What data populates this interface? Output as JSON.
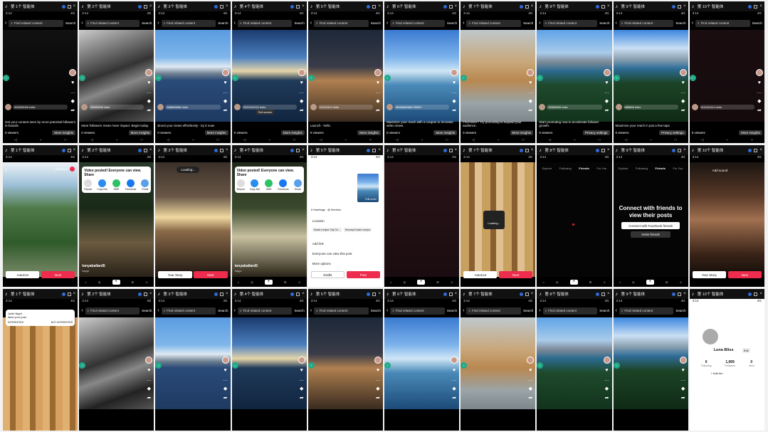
{
  "window_tabs": [
    "第 1个 智能体",
    "第 2个 智能体",
    "第 3个 智能体",
    "第 4个 智能体",
    "第 5个 智能体",
    "第 6个 智能体",
    "第 7个 智能体",
    "第 8个 智能体",
    "第 9个 智能体",
    "第 10个 智能体"
  ],
  "common": {
    "time": "3:14",
    "net": "4G",
    "search_placeholder": "Find related content",
    "search_btn": "Search",
    "viewers": "0 viewers",
    "more_insights": "More insights",
    "privacy_settings": "Privacy settings"
  },
  "row1": [
    {
      "img": "dark",
      "comment": "000000000 hello",
      "hint": "Get your content seen by more potential followers in-boards."
    },
    {
      "img": "industrial",
      "comment": "99999999 hello",
      "hint": "More followers mean more impact. Begin today."
    },
    {
      "img": "mountain",
      "comment": "888888888 hello",
      "hint": "Boost your views effortlessly - try it now!"
    },
    {
      "img": "sunset",
      "comment": "2222222222 hello",
      "hint": "",
      "full": "Full screen"
    },
    {
      "img": "woman",
      "comment": "111111111 hello",
      "hint": "Launch - hello"
    },
    {
      "img": "glacier",
      "comment": "MMMMMMM PARIS",
      "hint": "Maximize your reach with a coupon to increase video views."
    },
    {
      "img": "dog",
      "comment": "",
      "hint": "First-timer? Try promoting to expand your audience."
    },
    {
      "img": "lake",
      "comment": "55555555 hello",
      "hint": "Start promoting now to accelerate follower growth."
    },
    {
      "img": "lake2",
      "comment": "888888 hello",
      "hint": "Maximize your reach in just a few taps"
    },
    {
      "img": "dark2",
      "comment": "1111111111 hello",
      "hint": ""
    }
  ],
  "row2": {
    "selected": "Selected",
    "autocut": "AutoCut",
    "next": "Next",
    "share_title": "Video posted! Everyone can view. Share",
    "share_items": [
      "Repost",
      "Copy link",
      "SMS",
      "Facebook",
      "Email"
    ],
    "loading": "Loading...",
    "your_story": "Your Story",
    "username": "tonyaballard5",
    "sub": "happi",
    "edit_cover": "Edit cover",
    "location": "Location",
    "location_tag1": "Kuala Lumpur City Ce...",
    "location_tag2": "Sunway Kuala Lumpur",
    "add_link": "Add link",
    "privacy": "Everyone can view this post",
    "more_options": "More options",
    "drafts": "Drafts",
    "post": "Post",
    "tab_explore": "Explore",
    "tab_following": "Following",
    "tab_friends": "Friends",
    "tab_foryou": "For You",
    "connect_title": "Connect with friends to view their posts",
    "connect_fb": "Connect with Facebook friends",
    "invite": "Invite friends",
    "add_sound": "Add sound",
    "hashtags": "# Hashtags",
    "mention": "@ Mention"
  },
  "row3": {
    "notif_name": "Juliet Night",
    "notif_sub": "liked your post",
    "interested": "INTERESTED",
    "not_interested": "NOT INTERESTED",
    "profile_name": "Luna Bliss",
    "following": "0",
    "followers": "1,069",
    "likes": "0",
    "label_following": "Following",
    "label_followers": "Followers",
    "label_likes": "Likes",
    "add_bio": "+ Add bio",
    "edit": "Edit"
  }
}
